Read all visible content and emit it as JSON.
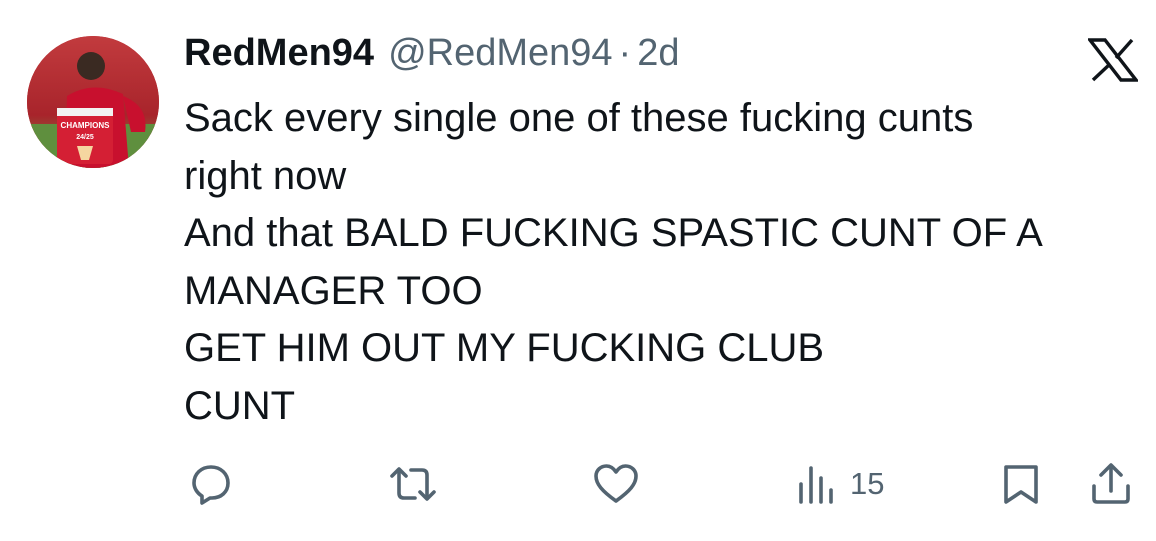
{
  "tweet": {
    "display_name": "RedMen94",
    "handle": "@RedMen94",
    "separator": "·",
    "time": "2d",
    "lines": [
      "Sack every single one of these fucking cunts",
      "right now",
      "And that BALD FUCKING SPASTIC CUNT OF A",
      "MANAGER TOO",
      "GET HIM OUT MY FUCKING CLUB",
      "CUNT"
    ]
  },
  "avatar": {
    "shirt_text_line1": "CHAMPIONS",
    "shirt_text_line2": "24/25"
  },
  "actions": {
    "reply_icon": "reply-icon",
    "retweet_icon": "retweet-icon",
    "like_icon": "heart-icon",
    "views_icon": "views-icon",
    "views_count": "15",
    "bookmark_icon": "bookmark-icon",
    "share_icon": "share-icon"
  },
  "colors": {
    "text": "#0f1419",
    "secondary": "#536471",
    "background": "#ffffff"
  }
}
